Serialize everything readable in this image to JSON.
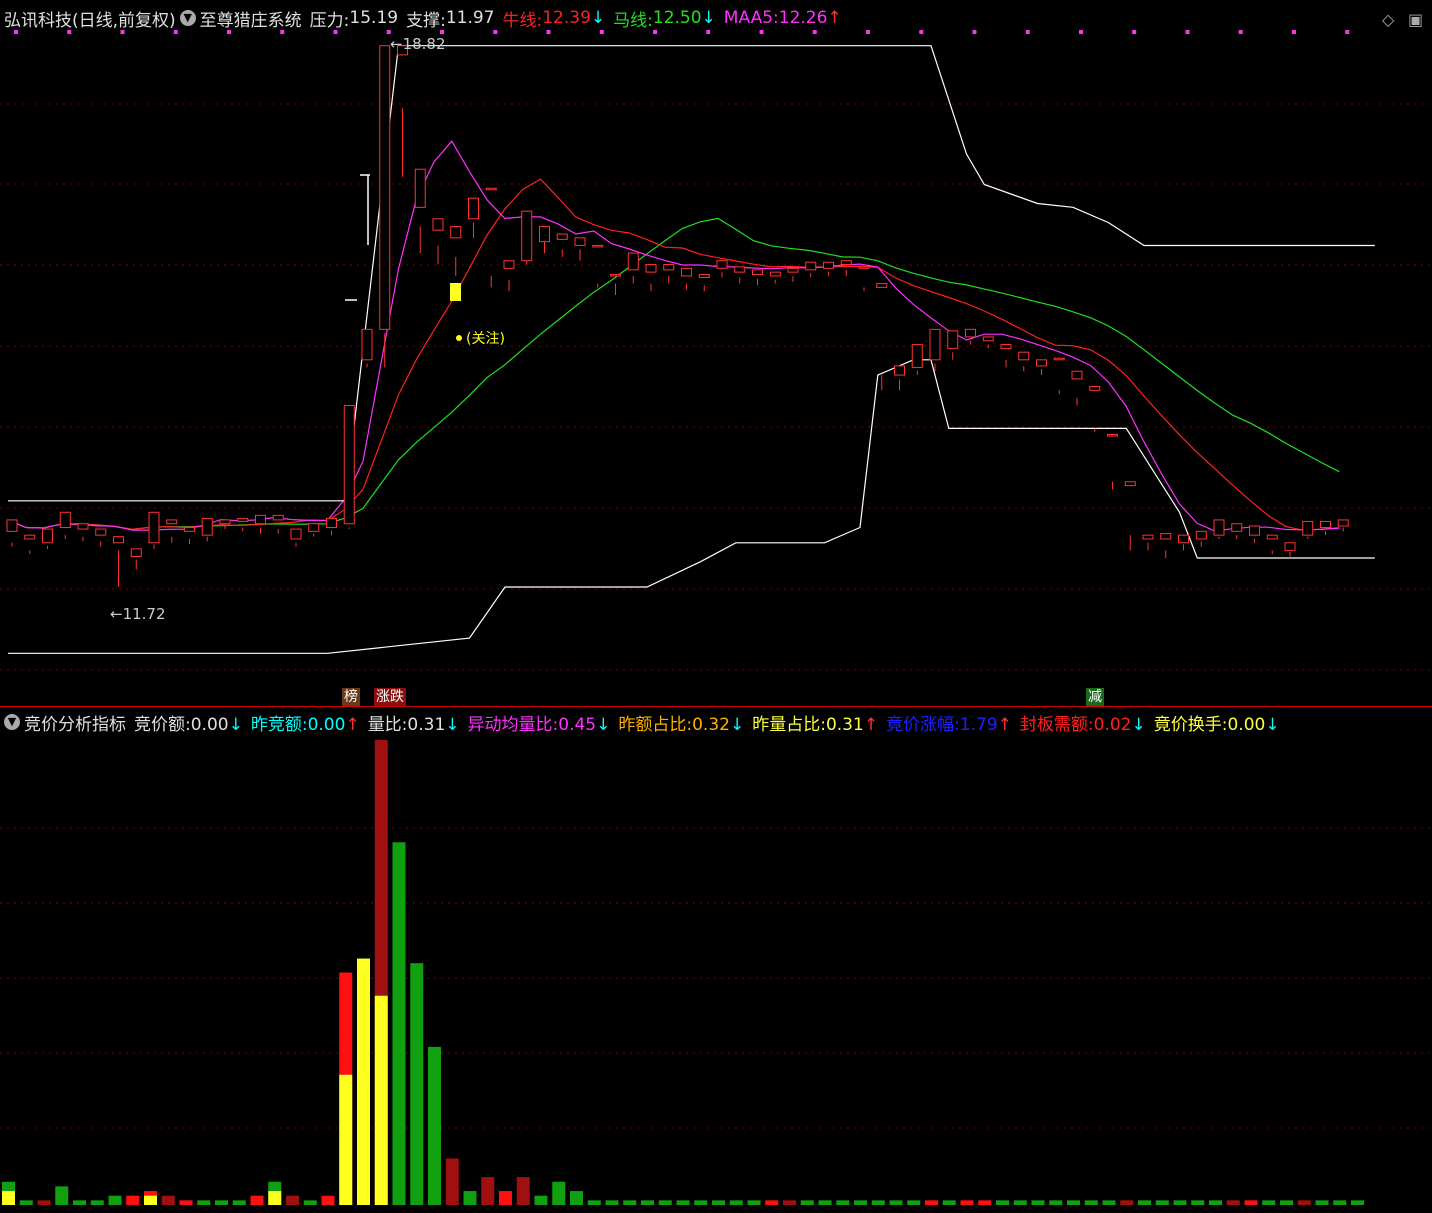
{
  "header": {
    "stock_name": "弘讯科技(日线,前复权)",
    "indicator_name": "至尊猎庄系统",
    "pressure_label": "压力:",
    "pressure_value": "15.19",
    "support_label": "支撑:",
    "support_value": "11.97",
    "bull_label": "牛线:",
    "bull_value": "12.39",
    "bull_arrow": "↓",
    "horse_label": "马线:",
    "horse_value": "12.50",
    "horse_arrow": "↓",
    "maa5_label": "MAA5:",
    "maa5_value": "12.26",
    "maa5_arrow": "↑"
  },
  "sub_header": {
    "indicator_name": "竞价分析指标",
    "items": [
      {
        "label": "竞价额:",
        "value": "0.00",
        "arrow": "↓",
        "color": "#e0e0e0",
        "arrow_color": "#00ffff"
      },
      {
        "label": "昨竞额:",
        "value": "0.00",
        "arrow": "↑",
        "color": "#00ffff",
        "arrow_color": "#ff3030"
      },
      {
        "label": "量比:",
        "value": "0.31",
        "arrow": "↓",
        "color": "#e0e0e0",
        "arrow_color": "#00ffff"
      },
      {
        "label": "异动均量比:",
        "value": "0.45",
        "arrow": "↓",
        "color": "#ff30ff",
        "arrow_color": "#00ffff"
      },
      {
        "label": "昨额占比:",
        "value": "0.32",
        "arrow": "↓",
        "color": "#ffb000",
        "arrow_color": "#00ffff"
      },
      {
        "label": "昨量占比:",
        "value": "0.31",
        "arrow": "↑",
        "color": "#ffff40",
        "arrow_color": "#ff3030"
      },
      {
        "label": "竟价涨幅:",
        "value": "1.79",
        "arrow": "↑",
        "color": "#2020ff",
        "arrow_color": "#ff3030"
      },
      {
        "label": "封板需额:",
        "value": "0.02",
        "arrow": "↓",
        "color": "#ff2020",
        "arrow_color": "#00ffff"
      },
      {
        "label": "竟价换手:",
        "value": "0.00",
        "arrow": "↓",
        "color": "#ffff40",
        "arrow_color": "#00ffff"
      }
    ]
  },
  "tags": {
    "bang": "榜",
    "zhangdie": "涨跌",
    "jian": "减"
  },
  "icons": {
    "diamond": "diamond-icon",
    "window": "window-icon"
  },
  "chart_data": [
    {
      "type": "candlestick",
      "title": "至尊猎庄系统",
      "annotations": {
        "high_mark": "18.82",
        "low_mark": "11.72",
        "note": "(关注)"
      },
      "ylim": [
        10.5,
        19.0
      ],
      "colors": {
        "up": "#ff3232",
        "down": "#54ffff",
        "ma_bull": "#ff2020",
        "ma_horse": "#20e020",
        "maa5": "#ff30ff",
        "pressure": "#ffffff",
        "support": "#ffffff",
        "top_dots": "#ff30ff"
      },
      "candles": [
        [
          12.45,
          12.6,
          12.3,
          12.25
        ],
        [
          12.35,
          12.4,
          12.2,
          12.15
        ],
        [
          12.3,
          12.48,
          12.26,
          12.22
        ],
        [
          12.5,
          12.7,
          12.4,
          12.35
        ],
        [
          12.48,
          12.55,
          12.38,
          12.32
        ],
        [
          12.4,
          12.48,
          12.32,
          12.25
        ],
        [
          12.3,
          12.38,
          12.2,
          11.72
        ],
        [
          12.12,
          12.22,
          12.08,
          11.95
        ],
        [
          12.3,
          12.7,
          12.28,
          12.22
        ],
        [
          12.55,
          12.6,
          12.38,
          12.3
        ],
        [
          12.45,
          12.5,
          12.35,
          12.28
        ],
        [
          12.4,
          12.62,
          12.38,
          12.32
        ],
        [
          12.55,
          12.6,
          12.52,
          12.48
        ],
        [
          12.58,
          12.62,
          12.5,
          12.45
        ],
        [
          12.55,
          12.66,
          12.5,
          12.42
        ],
        [
          12.6,
          12.66,
          12.48,
          12.42
        ],
        [
          12.35,
          12.48,
          12.3,
          12.25
        ],
        [
          12.45,
          12.55,
          12.42,
          12.38
        ],
        [
          12.5,
          12.62,
          12.46,
          12.4
        ],
        [
          12.55,
          14.1,
          12.5,
          12.48
        ],
        [
          14.7,
          15.1,
          14.65,
          14.6
        ],
        [
          15.1,
          18.82,
          15.05,
          14.6
        ],
        [
          18.7,
          18.82,
          18.0,
          17.1
        ],
        [
          16.7,
          17.2,
          16.45,
          16.1
        ],
        [
          16.4,
          16.55,
          16.2,
          15.95
        ],
        [
          16.3,
          16.45,
          16.05,
          15.8
        ],
        [
          16.55,
          16.82,
          16.5,
          16.3
        ],
        [
          16.95,
          16.95,
          15.8,
          15.65
        ],
        [
          15.9,
          16.0,
          15.75,
          15.6
        ],
        [
          16.0,
          16.65,
          16.2,
          15.95
        ],
        [
          16.25,
          16.45,
          16.25,
          16.1
        ],
        [
          16.28,
          16.35,
          16.15,
          16.05
        ],
        [
          16.2,
          16.3,
          16.15,
          16.0
        ],
        [
          16.2,
          16.2,
          15.7,
          15.65
        ],
        [
          15.8,
          15.82,
          15.7,
          15.55
        ],
        [
          15.88,
          16.1,
          15.8,
          15.7
        ],
        [
          15.85,
          15.95,
          15.7,
          15.6
        ],
        [
          15.88,
          15.95,
          15.8,
          15.7
        ],
        [
          15.8,
          15.9,
          15.7,
          15.62
        ],
        [
          15.78,
          15.82,
          15.68,
          15.6
        ],
        [
          15.9,
          16.0,
          15.85,
          15.78
        ],
        [
          15.85,
          15.92,
          15.78,
          15.7
        ],
        [
          15.82,
          15.88,
          15.76,
          15.68
        ],
        [
          15.8,
          15.85,
          15.75,
          15.7
        ],
        [
          15.85,
          15.9,
          15.8,
          15.72
        ],
        [
          15.88,
          15.98,
          15.84,
          15.78
        ],
        [
          15.9,
          15.98,
          15.86,
          15.8
        ],
        [
          15.95,
          16.0,
          15.88,
          15.8
        ],
        [
          15.9,
          15.92,
          15.65,
          15.6
        ],
        [
          15.65,
          15.7,
          14.5,
          14.3
        ],
        [
          14.5,
          14.62,
          14.44,
          14.3
        ],
        [
          14.6,
          14.9,
          14.56,
          14.5
        ],
        [
          14.7,
          15.1,
          14.65,
          14.55
        ],
        [
          14.85,
          15.08,
          14.8,
          14.7
        ],
        [
          15.0,
          15.1,
          14.95,
          14.9
        ],
        [
          14.95,
          15.0,
          14.9,
          14.85
        ],
        [
          14.85,
          14.9,
          14.7,
          14.6
        ],
        [
          14.7,
          14.8,
          14.62,
          14.55
        ],
        [
          14.62,
          14.7,
          14.58,
          14.5
        ],
        [
          14.7,
          14.72,
          14.3,
          14.25
        ],
        [
          14.45,
          14.55,
          14.2,
          14.1
        ],
        [
          14.3,
          14.35,
          13.8,
          13.75
        ],
        [
          13.7,
          13.72,
          13.1,
          13.0
        ],
        [
          13.05,
          13.1,
          12.4,
          12.2
        ],
        [
          12.35,
          12.4,
          12.3,
          12.2
        ],
        [
          12.35,
          12.42,
          12.2,
          12.1
        ],
        [
          12.3,
          12.4,
          12.28,
          12.2
        ],
        [
          12.35,
          12.45,
          12.32,
          12.25
        ],
        [
          12.4,
          12.6,
          12.38,
          12.35
        ],
        [
          12.45,
          12.55,
          12.4,
          12.35
        ],
        [
          12.4,
          12.52,
          12.35,
          12.3
        ],
        [
          12.35,
          12.4,
          12.2,
          12.15
        ],
        [
          12.2,
          12.3,
          12.18,
          12.1
        ],
        [
          12.4,
          12.58,
          12.38,
          12.35
        ],
        [
          12.5,
          12.58,
          12.45,
          12.4
        ],
        [
          12.52,
          12.6,
          12.5,
          12.45
        ]
      ],
      "pressure_line": [
        [
          0,
          12.85
        ],
        [
          19,
          12.85
        ],
        [
          22,
          18.82
        ],
        [
          52,
          18.82
        ],
        [
          54,
          17.4
        ],
        [
          55,
          17.0
        ],
        [
          58,
          16.75
        ],
        [
          60,
          16.7
        ],
        [
          62,
          16.5
        ],
        [
          64,
          16.2
        ],
        [
          77,
          16.2
        ]
      ],
      "support_line": [
        [
          0,
          10.85
        ],
        [
          18,
          10.85
        ],
        [
          26,
          11.05
        ],
        [
          28,
          11.72
        ],
        [
          36,
          11.72
        ],
        [
          39,
          12.05
        ],
        [
          41,
          12.3
        ],
        [
          46,
          12.3
        ],
        [
          48,
          12.5
        ],
        [
          49,
          14.5
        ],
        [
          51,
          14.7
        ],
        [
          52,
          14.7
        ],
        [
          53,
          13.8
        ],
        [
          63,
          13.8
        ],
        [
          66,
          12.7
        ],
        [
          67,
          12.1
        ],
        [
          77,
          12.1
        ]
      ]
    },
    {
      "type": "bar",
      "title": "竞价分析指标",
      "ylim": [
        0,
        100
      ],
      "colors": {
        "red": "#ff1010",
        "darkred": "#a01010",
        "green": "#10a010",
        "yellow": "#ffff20"
      },
      "values": [
        5,
        1,
        1,
        4,
        1,
        1,
        2,
        2,
        3,
        2,
        1,
        1,
        1,
        1,
        2,
        5,
        2,
        1,
        2,
        50,
        50,
        100,
        78,
        52,
        34,
        10,
        3,
        6,
        3,
        6,
        2,
        5,
        3,
        1,
        1,
        1,
        1,
        1,
        1,
        1,
        1,
        1,
        1,
        1,
        1,
        1,
        1,
        1,
        1,
        1,
        1,
        1,
        1,
        1,
        1,
        1,
        1,
        1,
        1,
        1,
        1,
        1,
        1,
        1,
        1,
        1,
        1,
        1,
        1,
        1,
        1,
        1,
        1,
        1,
        1,
        1,
        1
      ],
      "overlay_values": [
        3,
        0,
        0,
        0,
        0,
        0,
        0,
        0,
        2,
        0,
        0,
        0,
        0,
        0,
        0,
        3,
        0,
        0,
        0,
        28,
        53,
        45,
        0,
        0,
        0,
        0,
        0,
        0,
        0,
        0,
        0,
        0,
        0,
        0,
        0,
        0,
        0,
        0,
        0,
        0,
        0,
        0,
        0,
        0,
        0,
        0,
        0,
        0,
        0,
        0,
        0,
        0,
        0,
        0,
        0,
        0,
        0,
        0,
        0,
        0,
        0,
        0,
        0,
        0,
        0,
        0,
        0,
        0,
        0,
        0,
        0,
        0,
        0,
        0,
        0,
        0,
        0
      ],
      "bar_color_keys": [
        "green",
        "green",
        "darkred",
        "green",
        "green",
        "green",
        "green",
        "red",
        "red",
        "darkred",
        "red",
        "green",
        "green",
        "green",
        "red",
        "green",
        "darkred",
        "green",
        "red",
        "red",
        "red",
        "darkred",
        "green",
        "green",
        "green",
        "darkred",
        "green",
        "darkred",
        "red",
        "darkred",
        "green",
        "green",
        "green",
        "green",
        "green",
        "green",
        "green",
        "green",
        "green",
        "green",
        "green",
        "green",
        "green",
        "red",
        "darkred",
        "green",
        "green",
        "green",
        "green",
        "green",
        "green",
        "green",
        "red",
        "green",
        "red",
        "red",
        "green",
        "green",
        "green",
        "green",
        "green",
        "green",
        "green",
        "darkred",
        "green",
        "green",
        "green",
        "green",
        "green",
        "darkred",
        "red",
        "green",
        "green",
        "darkred",
        "green",
        "green",
        "green"
      ]
    }
  ]
}
